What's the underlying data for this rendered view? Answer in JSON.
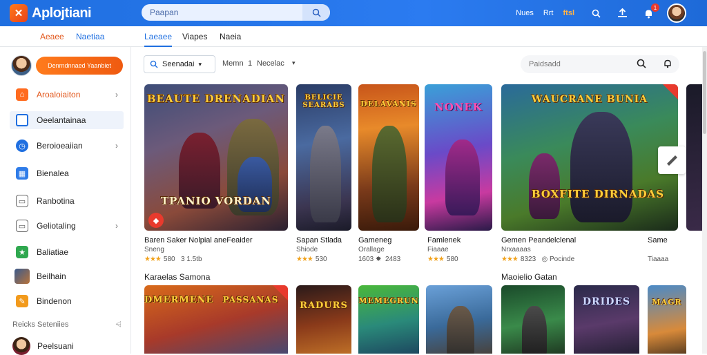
{
  "header": {
    "app_name": "Aplojtiani",
    "search_placeholder": "Paapan",
    "links": [
      "Nues",
      "Rrt"
    ],
    "orange_link": "ftsl",
    "notification_count": "1",
    "colors": {
      "bar": "#1f6fe0",
      "accent": "#ff7a1a"
    }
  },
  "subnav": {
    "left_items": [
      "Aeaee",
      "Naetiaa"
    ],
    "tabs": [
      "Laeaee",
      "Viapes",
      "Naeia"
    ]
  },
  "sidebar": {
    "user_pill": "Denrndnnaed Yaanbiet",
    "items": [
      {
        "label": "Aroaloiaiton",
        "icon": "home-icon",
        "chevron": true
      },
      {
        "label": "Oeelantainaa",
        "icon": "window-icon",
        "chevron": false
      },
      {
        "label": "Beroioeaiian",
        "icon": "clock-icon",
        "chevron": true
      },
      {
        "label": "Bienalea",
        "icon": "building-icon",
        "chevron": false
      },
      {
        "label": "Ranbotina",
        "icon": "bookmark-icon",
        "chevron": false
      },
      {
        "label": "Geliotaling",
        "icon": "monitor-icon",
        "chevron": true
      },
      {
        "label": "Baliatiae",
        "icon": "star-icon",
        "chevron": false
      },
      {
        "label": "Beilhain",
        "icon": "game-thumb-icon",
        "chevron": false
      },
      {
        "label": "Bindenon",
        "icon": "tag-icon",
        "chevron": false
      }
    ],
    "section_label": "Reicks Seteniies",
    "bottom_user": "Peelsuani"
  },
  "main": {
    "filter_dropdown": "Seenadai",
    "filter_2_a": "Memn",
    "filter_2_b": "1",
    "filter_2_c": "Necelac",
    "search_placeholder": "Paidsadd",
    "row1": [
      {
        "title": "Baren Saker Nolpial aneFeaider",
        "sub": "Sneng",
        "stars": "★★★",
        "rating": "580",
        "extra": "3 1.5tb",
        "art": "BEAUTE DRENADIAN",
        "art2": "TPANIO VORDAN"
      },
      {
        "title": "Sapan Stlada",
        "sub": "Shiode",
        "stars": "★★★",
        "rating": "530",
        "extra": "",
        "art": "BELICIE SEARABS",
        "art2": ""
      },
      {
        "title": "Gameneg",
        "sub": "Orallage",
        "stars": "",
        "rating": "1603 ✸",
        "extra": "2483",
        "art": "DELAVANIS",
        "art2": ""
      },
      {
        "title": "Famlenek",
        "sub": "Fiaaae",
        "stars": "★★★",
        "rating": "580",
        "extra": "",
        "art": "NONEK",
        "art2": ""
      },
      {
        "title": "Gemen Peandelclenal",
        "sub": "Nrxaaaas",
        "stars": "★★★",
        "rating": "8323",
        "extra": "Pocinde",
        "art": "WAUCRANE BUNIA",
        "art2": "BOXFITE DIRNADAS"
      },
      {
        "title": "Same",
        "sub": "",
        "stars": "",
        "rating": "Tiaaaa",
        "extra": "",
        "art": "",
        "art2": ""
      }
    ],
    "section_left": "Karaelas Samona",
    "section_right": "Maoielio Gatan",
    "row2_art": [
      "DMERMENE",
      "PASSANAS",
      "RADURS",
      "MEMEGRUN",
      "",
      "",
      "DRIDES",
      "MAGR"
    ]
  }
}
